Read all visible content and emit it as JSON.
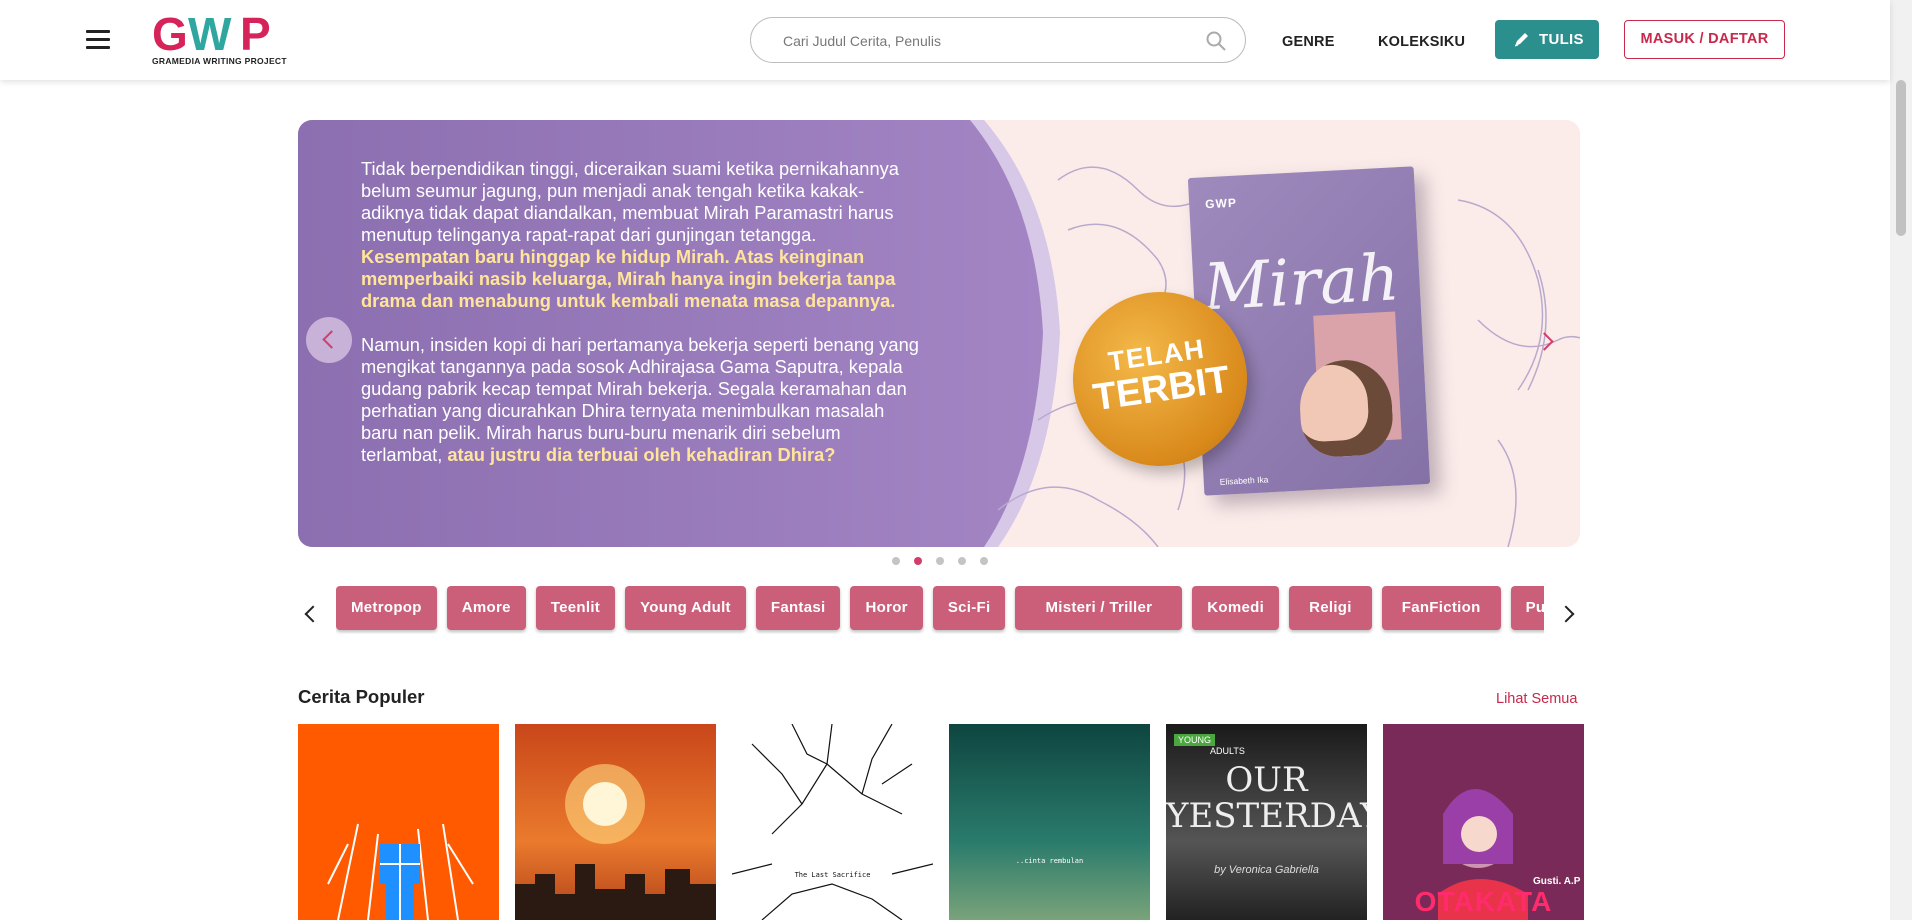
{
  "header": {
    "logo_text": "GWP",
    "logo_subtitle": "GRAMEDIA WRITING PROJECT",
    "search_placeholder": "Cari Judul Cerita, Penulis",
    "nav": {
      "genre": "GENRE",
      "collection": "KOLEKSIKU"
    },
    "write_button": "TULIS",
    "login_button": "MASUK / DAFTAR"
  },
  "banner": {
    "paragraph1_plain": "Tidak berpendidikan tinggi, diceraikan suami ketika pernikahannya belum seumur jagung, pun menjadi anak tengah ketika kakak-adiknya tidak dapat diandalkan, membuat Mirah Paramastri harus menutup telinganya rapat-rapat dari gunjingan tetangga. ",
    "paragraph1_highlight": "Kesempatan baru hinggap ke hidup Mirah. Atas keinginan memperbaiki nasib keluarga, Mirah hanya ingin bekerja tanpa drama dan menabung untuk kembali menata masa depannya.",
    "paragraph2_plain": "Namun, insiden kopi di hari pertamanya bekerja seperti benang yang mengikat tangannya pada sosok Adhirajasa Gama Saputra, kepala gudang pabrik kecap tempat Mirah bekerja. Segala keramahan dan perhatian yang dicurahkan Dhira ternyata menimbulkan masalah baru nan pelik. Mirah harus buru-buru menarik diri sebelum terlambat, ",
    "paragraph2_highlight": "atau justru dia terbuai oleh kehadiran Dhira?",
    "book_publisher": "GWP",
    "book_title": "Mirah",
    "book_author": "Elisabeth Ika",
    "badge_top": "TELAH",
    "badge_bottom": "TERBIT",
    "slide_count": 5,
    "active_slide": 2
  },
  "genres": [
    "Metropop",
    "Amore",
    "Teenlit",
    "Young Adult",
    "Fantasi",
    "Horor",
    "Sci-Fi",
    "Misteri / Triller",
    "Komedi",
    "Religi",
    "FanFiction",
    "Puisi"
  ],
  "popular": {
    "title": "Cerita Populer",
    "see_all": "Lihat Semua",
    "covers": [
      {
        "name": "cover-orange-title",
        "bg": "#ff5a00",
        "label": ""
      },
      {
        "name": "cover-sunset-city",
        "bg": "#e0551a",
        "label": ""
      },
      {
        "name": "cover-last-sacrifice",
        "bg": "#ffffff",
        "label": "The Last Sacrifice"
      },
      {
        "name": "cover-cinta-rembulan",
        "bg": "#1f5f57",
        "label": "..cinta rembulan"
      },
      {
        "name": "cover-our-yesterday",
        "bg": "#2b2b2b",
        "label": "OUR YESTERDAY",
        "author": "by Veronica Gabriella",
        "tag_top": "YOUNG",
        "tag_bottom": "ADULTS"
      },
      {
        "name": "cover-otakata",
        "bg": "#7a2a59",
        "label": "OTAKATA",
        "author": "Gusti. A.P"
      }
    ]
  },
  "colors": {
    "accent": "#c8284a",
    "teal": "#2a8f8d",
    "chip": "#cb5f79",
    "banner_purple": "#9a7dbb"
  }
}
